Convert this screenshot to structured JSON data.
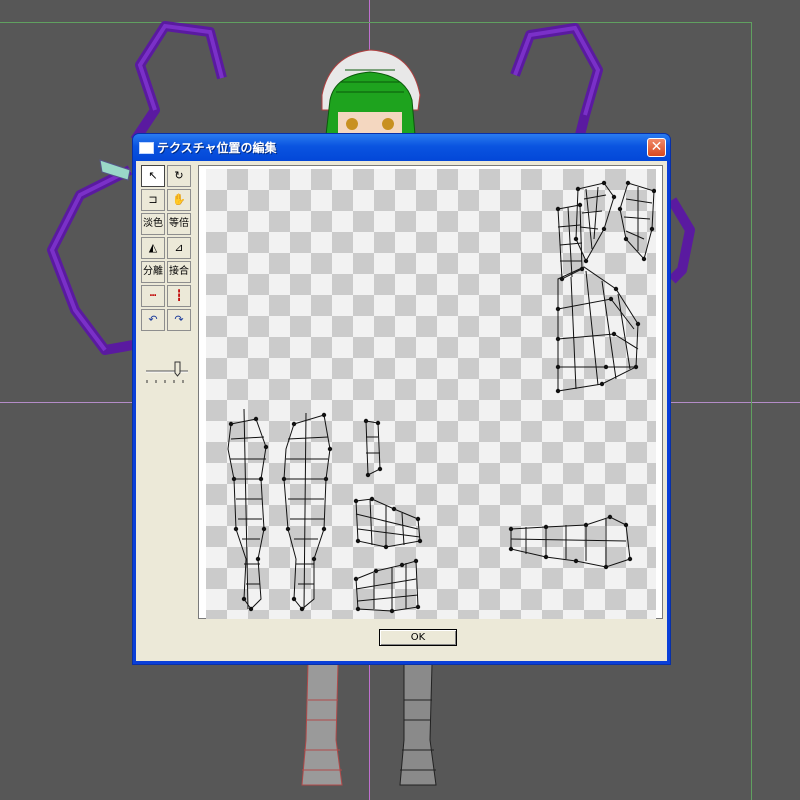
{
  "window": {
    "title": "テクスチャ位置の編集",
    "close_glyph": "✕"
  },
  "toolbox": {
    "tools": [
      {
        "name": "select-tool-button",
        "icon": "pointer-arrow-icon",
        "label": "↖",
        "active": true
      },
      {
        "name": "rotate-tool-button",
        "icon": "rotate-icon",
        "label": "↻"
      },
      {
        "name": "scale-tool-button",
        "icon": "scale-icon",
        "label": "⊐"
      },
      {
        "name": "pan-tool-button",
        "icon": "hand-icon",
        "label": "✋"
      }
    ],
    "pale_label": "淡色",
    "equal_label": "等倍",
    "split_label": "分離",
    "join_label": "接合",
    "undo_icon": "undo-icon",
    "redo_icon": "redo-icon"
  },
  "ok_button": {
    "label": "OK"
  },
  "colors": {
    "titlebar": "#0a54e0",
    "dialog_bg": "#ece9d8",
    "viewport_bg": "#575757",
    "wing": "#5a1aa0",
    "checker_light": "#f2f2f2",
    "checker_dark": "#cbcbcb"
  }
}
